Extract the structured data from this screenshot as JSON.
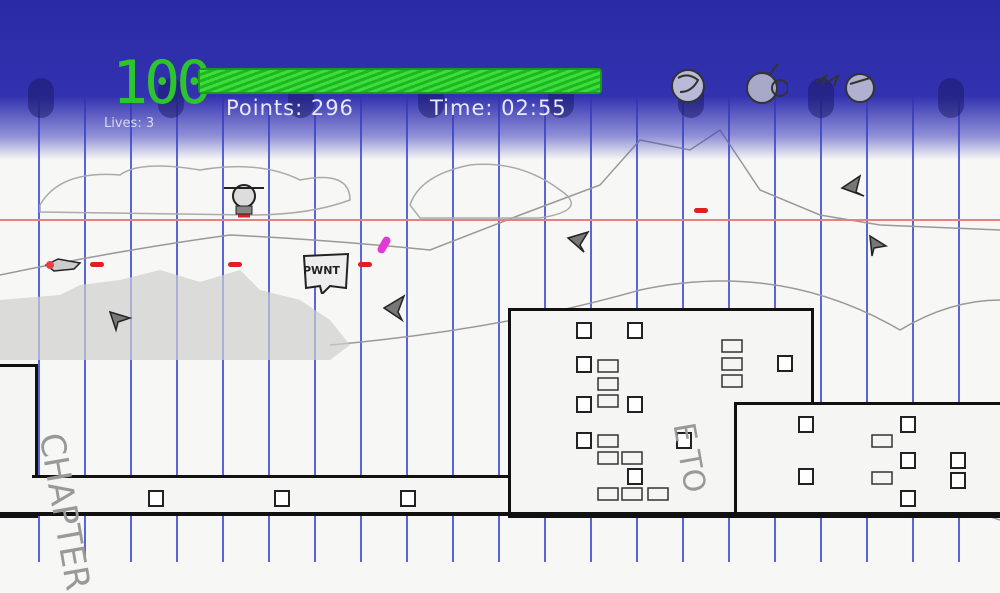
{
  "hud": {
    "health_value": "100",
    "health_fraction": 1.0,
    "lives_text": "Lives: 3",
    "points_text": "Points: 296",
    "time_text": "Time: 02:55",
    "weapons": [
      "grenade-icon",
      "bomb-icon",
      "speed-arrows-icon"
    ]
  },
  "scene": {
    "speech_bubble_text": "PWNT",
    "wall_graffiti": [
      "CHAPTER",
      "E TO"
    ]
  },
  "colors": {
    "hud_blue": "#2a2aa6",
    "health_green": "#2ec42e",
    "bullet_red": "#e02020",
    "paper_line_blue": "#3b4fd0",
    "margin_red": "#e98080"
  }
}
